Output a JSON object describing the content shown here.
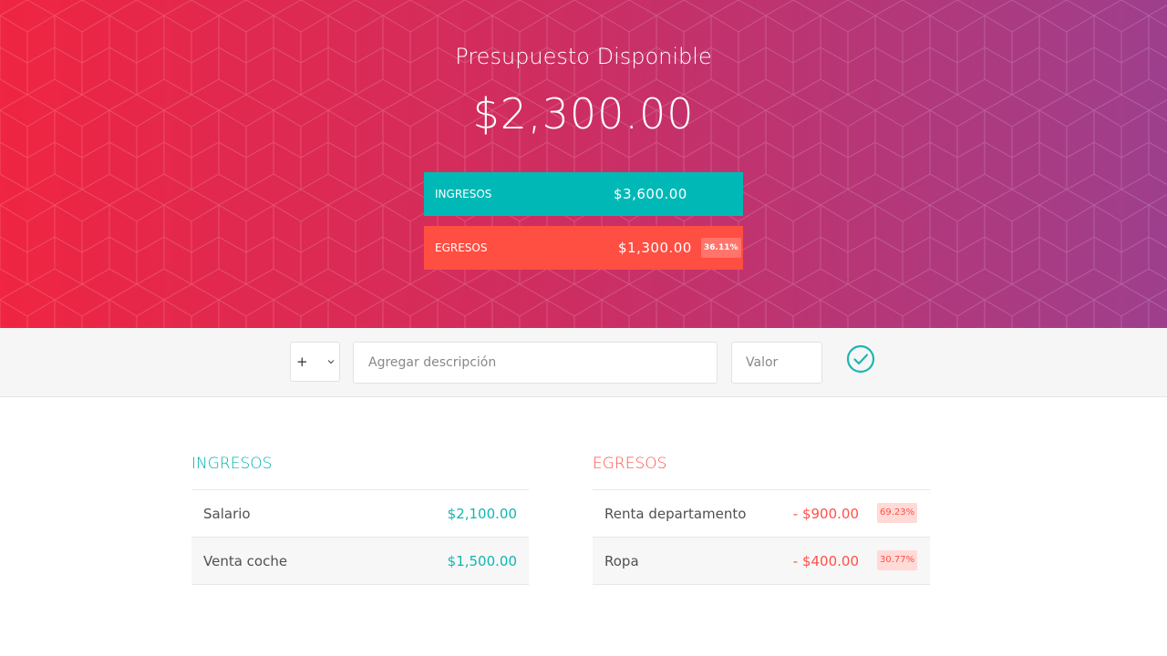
{
  "header": {
    "title": "Presupuesto Disponible",
    "budget": "$2,300.00"
  },
  "summary": {
    "income_label": "Ingresos",
    "income_value": "$3,600.00",
    "expenses_label": "Egresos",
    "expenses_value": "$1,300.00",
    "expenses_percentage": "36.11%"
  },
  "add_form": {
    "type_selected": "+",
    "description_placeholder": "Agregar descripción",
    "value_placeholder": "Valor"
  },
  "lists": {
    "income": {
      "title": "Ingresos",
      "items": [
        {
          "description": "Salario",
          "value": "$2,100.00"
        },
        {
          "description": "Venta coche",
          "value": "$1,500.00"
        }
      ]
    },
    "expenses": {
      "title": "Egresos",
      "items": [
        {
          "description": "Renta departamento",
          "value": "- $900.00",
          "percentage": "69.23%"
        },
        {
          "description": "Ropa",
          "value": "- $400.00",
          "percentage": "30.77%"
        }
      ]
    }
  },
  "colors": {
    "gradient_start": "#ef2541",
    "gradient_end": "#9e3f8d",
    "income_accent": "#00b9b6",
    "expense_accent": "#ff4e42"
  },
  "icons": {
    "type_dropdown": "chevron-down-icon",
    "add_button": "check-circle-icon"
  }
}
